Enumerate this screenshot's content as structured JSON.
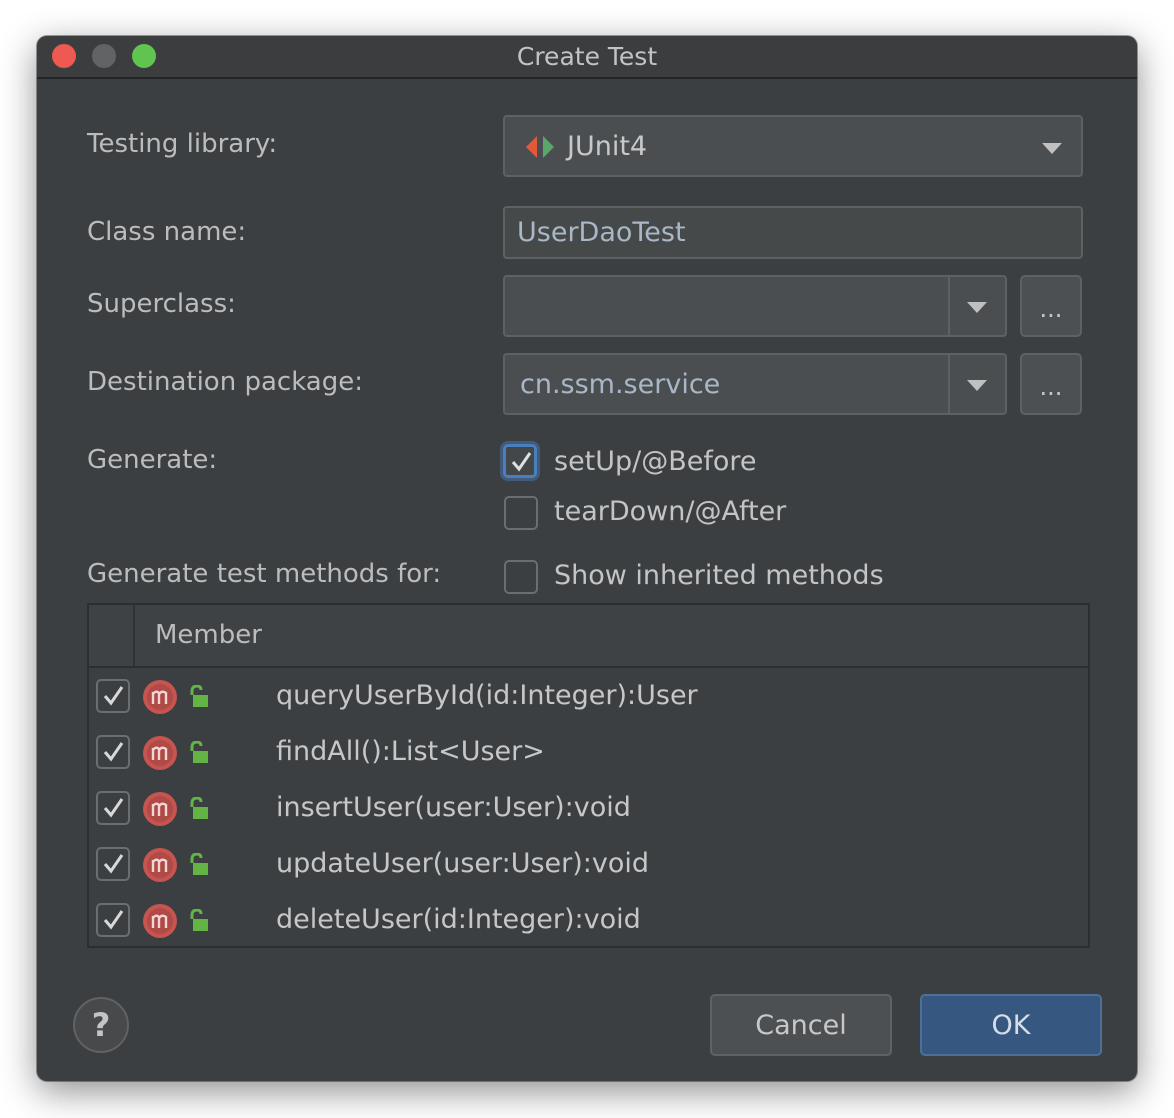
{
  "window": {
    "title": "Create Test"
  },
  "form": {
    "testing_library_label": "Testing library:",
    "testing_library_value": "JUnit4",
    "class_name_label": "Class name:",
    "class_name_value": "UserDaoTest",
    "superclass_label": "Superclass:",
    "superclass_value": "",
    "destination_package_label": "Destination package:",
    "destination_package_value": "cn.ssm.service",
    "browse_label": "...",
    "generate_label": "Generate:",
    "generate_options": [
      {
        "label": "setUp/@Before",
        "checked": true
      },
      {
        "label": "tearDown/@After",
        "checked": false
      }
    ],
    "generate_methods_label": "Generate test methods for:",
    "show_inherited_label": "Show inherited methods",
    "show_inherited_checked": false
  },
  "table": {
    "column_header": "Member",
    "rows": [
      {
        "signature": "queryUserById(id:Integer):User",
        "checked": true,
        "icon": "method-icon",
        "visibility_icon": "public-lock-icon"
      },
      {
        "signature": "findAll():List<User>",
        "checked": true,
        "icon": "method-icon",
        "visibility_icon": "public-lock-icon"
      },
      {
        "signature": "insertUser(user:User):void",
        "checked": true,
        "icon": "method-icon",
        "visibility_icon": "public-lock-icon"
      },
      {
        "signature": "updateUser(user:User):void",
        "checked": true,
        "icon": "method-icon",
        "visibility_icon": "public-lock-icon"
      },
      {
        "signature": "deleteUser(id:Integer):void",
        "checked": true,
        "icon": "method-icon",
        "visibility_icon": "public-lock-icon"
      }
    ]
  },
  "footer": {
    "help_label": "?",
    "cancel_label": "Cancel",
    "ok_label": "OK"
  },
  "colors": {
    "dialog_bg": "#3c3f41",
    "field_bg": "#45494a",
    "accent_blue": "#365880",
    "method_icon": "#c75450",
    "lock_green": "#62b543",
    "junit_red": "#e05a3a",
    "junit_green": "#59a869"
  }
}
